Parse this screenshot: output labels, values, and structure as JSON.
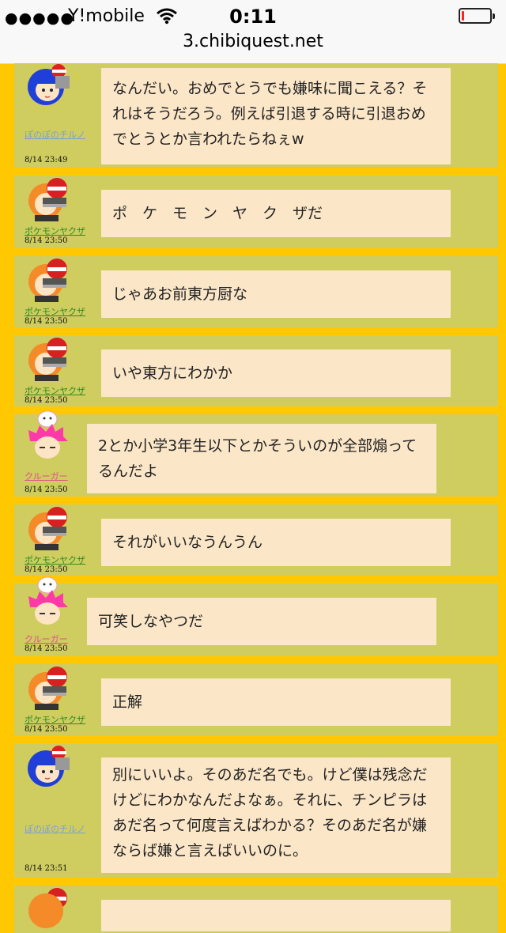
{
  "status": {
    "signal": "●●●●●",
    "carrier": "Y!mobile",
    "time": "0:11",
    "battery_level": 0.1,
    "url": "3.chibiquest.net"
  },
  "messages": [
    {
      "name": "ぽのぽのチルノ",
      "name_color": "blue",
      "avatar": "blue-hair-avatar",
      "time": "8/14 23:49",
      "text": "なんだい。おめでとうでも嫌味に聞こえる？それはそうだろう。例えば引退する時に引退おめでとうとか言われたらねぇw"
    },
    {
      "name": "ポケモンヤクザ",
      "name_color": "green",
      "avatar": "orange-hair-avatar",
      "time": "8/14 23:50",
      "text": "ポ　ケ　モ　ン　ヤ　ク　ザだ"
    },
    {
      "name": "ポケモンヤクザ",
      "name_color": "green",
      "avatar": "orange-hair-avatar",
      "time": "8/14 23:50",
      "text": "じゃあお前東方厨な"
    },
    {
      "name": "ポケモンヤクザ",
      "name_color": "green",
      "avatar": "orange-hair-avatar",
      "time": "8/14 23:50",
      "text": "いや東方にわかか"
    },
    {
      "name": "クルーガー",
      "name_color": "pink",
      "avatar": "pink-hair-avatar",
      "time": "8/14 23:50",
      "text": "2とか小学3年生以下とかそういのが全部煽ってるんだよ"
    },
    {
      "name": "ポケモンヤクザ",
      "name_color": "green",
      "avatar": "orange-hair-avatar",
      "time": "8/14 23:50",
      "text": "それがいいなうんうん"
    },
    {
      "name": "クルーガー",
      "name_color": "pink",
      "avatar": "pink-hair-avatar",
      "time": "8/14 23:50",
      "text": "可笑しなやつだ"
    },
    {
      "name": "ポケモンヤクザ",
      "name_color": "green",
      "avatar": "orange-hair-avatar",
      "time": "8/14 23:50",
      "text": "正解"
    },
    {
      "name": "ぽのぽのチルノ",
      "name_color": "blue",
      "avatar": "blue-hair-avatar",
      "time": "8/14 23:51",
      "text": "別にいいよ。そのあだ名でも。けど僕は残念だけどにわかなんだよなぁ。それに、チンピラはあだ名って何度言えばわかる？そのあだ名が嫌ならば嫌と言えばいいのに。"
    }
  ]
}
